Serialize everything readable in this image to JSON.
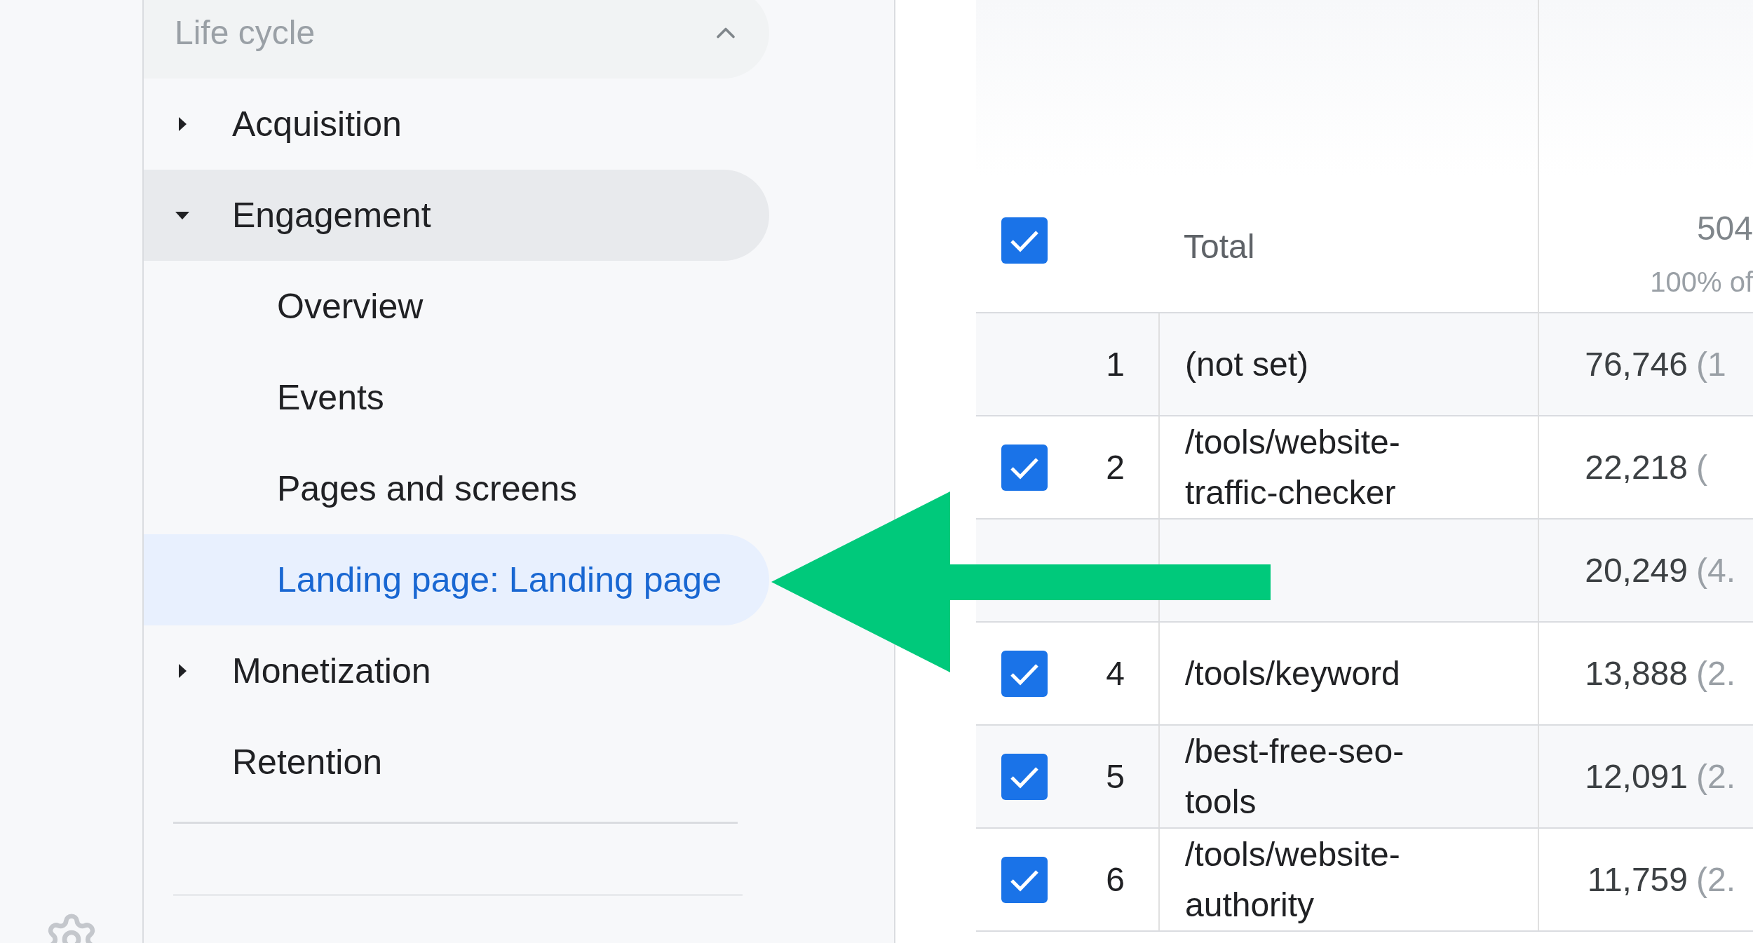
{
  "nav": {
    "sections": [
      {
        "label": "Life cycle",
        "expanded": true,
        "items": [
          {
            "label": "Acquisition",
            "expanded": false,
            "selected": false
          },
          {
            "label": "Engagement",
            "expanded": true,
            "selected": false,
            "children": [
              {
                "label": "Overview",
                "selected": false
              },
              {
                "label": "Events",
                "selected": false
              },
              {
                "label": "Pages and screens",
                "selected": false
              },
              {
                "label": "Landing page: Landing page",
                "selected": true
              }
            ]
          },
          {
            "label": "Monetization",
            "expanded": false,
            "selected": false
          },
          {
            "label": "Retention",
            "selected": false
          }
        ]
      }
    ]
  },
  "table": {
    "total": {
      "checked": true,
      "label": "Total",
      "value": "504",
      "share": "100% of"
    },
    "rows": [
      {
        "index": "1",
        "checked": false,
        "page": "(not set)",
        "value": "76,746",
        "share": "(1"
      },
      {
        "index": "2",
        "checked": true,
        "page": "/tools/website-traffic-checker",
        "value": "22,218",
        "share": "("
      },
      {
        "value": "20,249",
        "share": "(4."
      },
      {
        "index": "4",
        "checked": true,
        "page": "/tools/keyword",
        "value": "13,888",
        "share": "(2."
      },
      {
        "index": "5",
        "checked": true,
        "page": "/best-free-seo-tools",
        "value": "12,091",
        "share": "(2."
      },
      {
        "index": "6",
        "checked": true,
        "page": "/tools/website-authority",
        "value": "11,759",
        "share": "(2."
      }
    ]
  },
  "annotation": {
    "kind": "arrow"
  }
}
